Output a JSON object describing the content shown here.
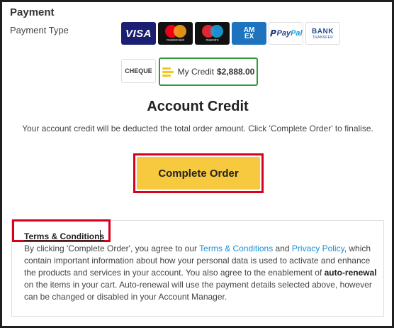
{
  "payment": {
    "title": "Payment",
    "type_label": "Payment Type",
    "methods": {
      "visa": "VISA",
      "mastercard": "mastercard",
      "maestro": "maestro",
      "amex_top": "AM",
      "amex_bottom": "EX",
      "paypal_pay": "Pay",
      "paypal_pal": "Pal",
      "bank_line1": "BANK",
      "bank_line2": "TRANSFER",
      "cheque": "CHEQUE",
      "my_credit_label": "My Credit",
      "my_credit_amount": "$2,888.00"
    }
  },
  "account_credit": {
    "heading": "Account Credit",
    "description": "Your account credit will be deducted the total order amount. Click 'Complete Order' to finalise.",
    "button_label": "Complete Order"
  },
  "terms": {
    "title": "Terms & Conditions",
    "text_1": "By clicking 'Complete Order', you agree to our ",
    "link_terms": "Terms & Conditions",
    "text_2": " and ",
    "link_privacy": "Privacy Policy",
    "text_3": ", which contain important information about how your personal data is used to activate and enhance the products and services in your account. You also agree to the enablement of ",
    "bold_auto_renewal": "auto-renewal",
    "text_4": " on the items in your cart. Auto-renewal will use the payment details selected above, however can be changed or disabled in your Account Manager."
  },
  "colors": {
    "highlight_red": "#d8001b",
    "button_yellow": "#f7c93e",
    "credit_green": "#2a9d3a",
    "link_blue": "#1a8fd6"
  }
}
